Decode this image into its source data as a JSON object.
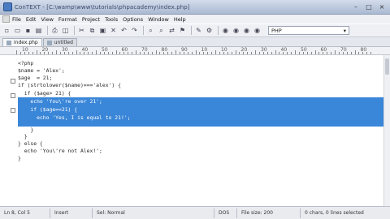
{
  "window": {
    "title": "ConTEXT - [C:\\wamp\\www\\tutorials\\phpacademy\\index.php]"
  },
  "menu": {
    "items": [
      "File",
      "Edit",
      "View",
      "Format",
      "Project",
      "Tools",
      "Options",
      "Window",
      "Help"
    ]
  },
  "toolbar": {
    "language_select": "PHP",
    "dropdown_arrow": "▾"
  },
  "tabs": [
    {
      "label": "index.php",
      "active": true
    },
    {
      "label": "untitled",
      "active": false
    }
  ],
  "ruler": {
    "numbers": [
      "10",
      "20",
      "30",
      "40",
      "50",
      "60",
      "70",
      "80",
      "90",
      "10",
      "10",
      "20",
      "30",
      "40",
      "50",
      "60",
      "70",
      "80"
    ]
  },
  "code": {
    "lines": [
      "<?php",
      "$name = 'Alex';",
      "$age  = 21;",
      "if (strtolower($name)==='alex') {",
      "  if ($age> 21) {",
      "    echo 'You\\'re over 21';",
      "    if ($age==21) {",
      "      echo 'Yes, I is equal to 21!';",
      "    }",
      "  }",
      "} else {",
      "  echo 'You\\'re not Alex!';",
      "}"
    ]
  },
  "status": {
    "position": "Ln 8, Col 5",
    "mode": "Insert",
    "highlighter": "Sel: Normal",
    "encoding": "DOS",
    "filesize": "File size: 200",
    "selection": "0 chars, 0 lines selected"
  }
}
